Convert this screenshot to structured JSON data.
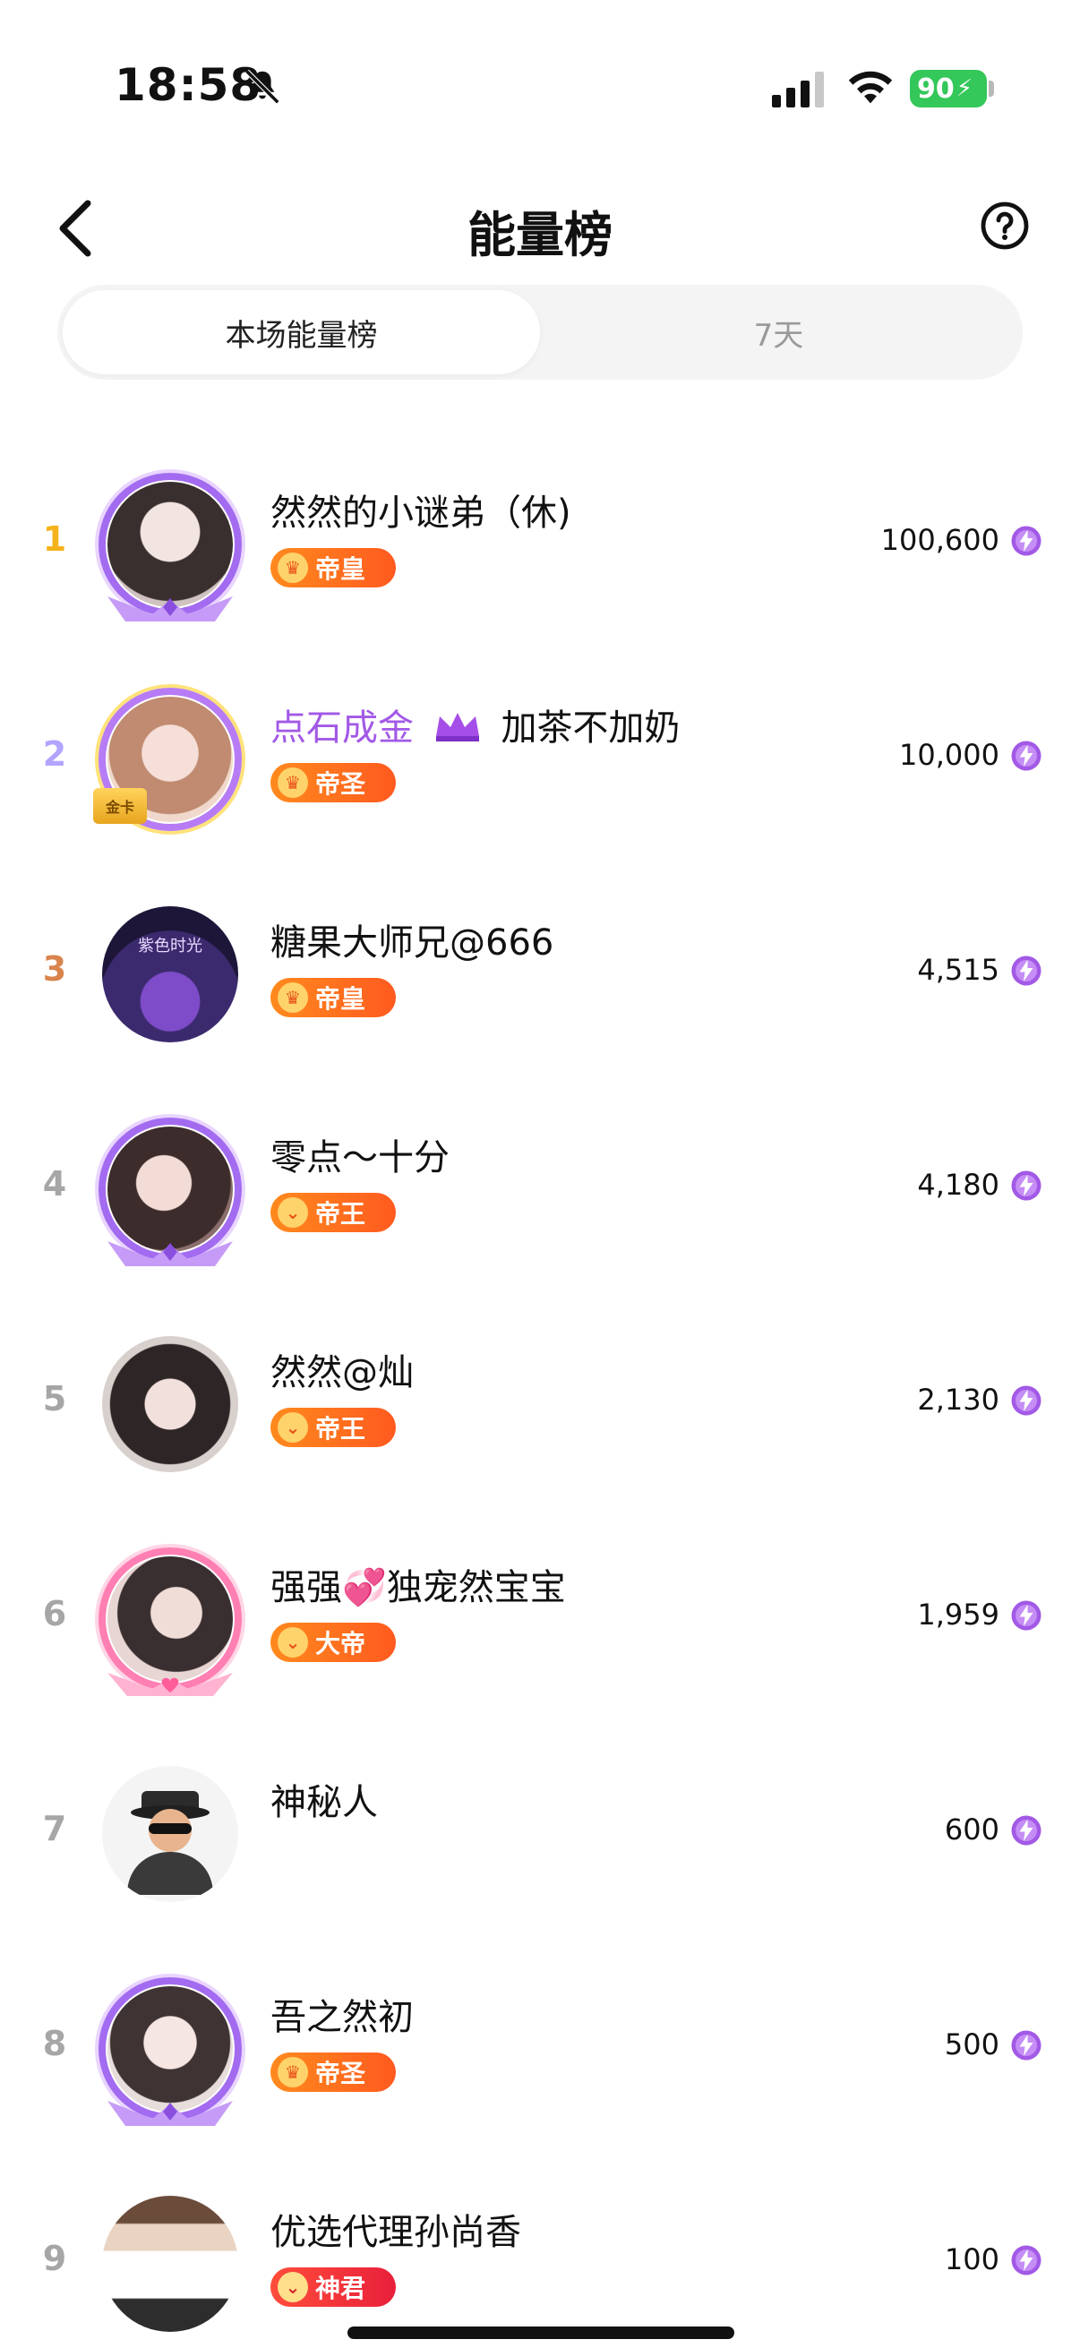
{
  "status_bar": {
    "time": "18:58",
    "battery": "90"
  },
  "header": {
    "title": "能量榜"
  },
  "tabs": [
    {
      "label": "本场能量榜",
      "active": true
    },
    {
      "label": "7天",
      "active": false
    }
  ],
  "rankings": [
    {
      "rank": "1",
      "name": "然然的小谜弟（休)",
      "name_prefix": "",
      "badge": "帝皇",
      "score": "100,600",
      "rank_color": "#f5b31b"
    },
    {
      "rank": "2",
      "name": "加茶不加奶",
      "name_prefix": "点石成金",
      "badge": "帝圣",
      "score": "10,000",
      "rank_color": "#b2a5ff",
      "card_label": "金卡"
    },
    {
      "rank": "3",
      "name": "糖果大师兄@666",
      "name_prefix": "",
      "badge": "帝皇",
      "score": "4,515",
      "rank_color": "#d9844d",
      "avatar_text": "紫色时光"
    },
    {
      "rank": "4",
      "name": "零点～十分",
      "name_prefix": "",
      "badge": "帝王",
      "score": "4,180",
      "rank_color": "#a6a6a6"
    },
    {
      "rank": "5",
      "name": "然然@灿",
      "name_prefix": "",
      "badge": "帝王",
      "score": "2,130",
      "rank_color": "#a6a6a6"
    },
    {
      "rank": "6",
      "name": "强强💞独宠然宝宝",
      "name_prefix": "",
      "badge": "大帝",
      "score": "1,959",
      "rank_color": "#a6a6a6"
    },
    {
      "rank": "7",
      "name": "神秘人",
      "name_prefix": "",
      "badge": "",
      "score": "600",
      "rank_color": "#a6a6a6"
    },
    {
      "rank": "8",
      "name": "吾之然初",
      "name_prefix": "",
      "badge": "帝圣",
      "score": "500",
      "rank_color": "#a6a6a6"
    },
    {
      "rank": "9",
      "name": "优选代理孙尚香",
      "name_prefix": "",
      "badge": "神君",
      "score": "100",
      "rank_color": "#a6a6a6"
    }
  ],
  "colors": {
    "accent_purple": "#a259e6",
    "badge_orange": "#ff6a1f",
    "battery_green": "#34c759"
  }
}
